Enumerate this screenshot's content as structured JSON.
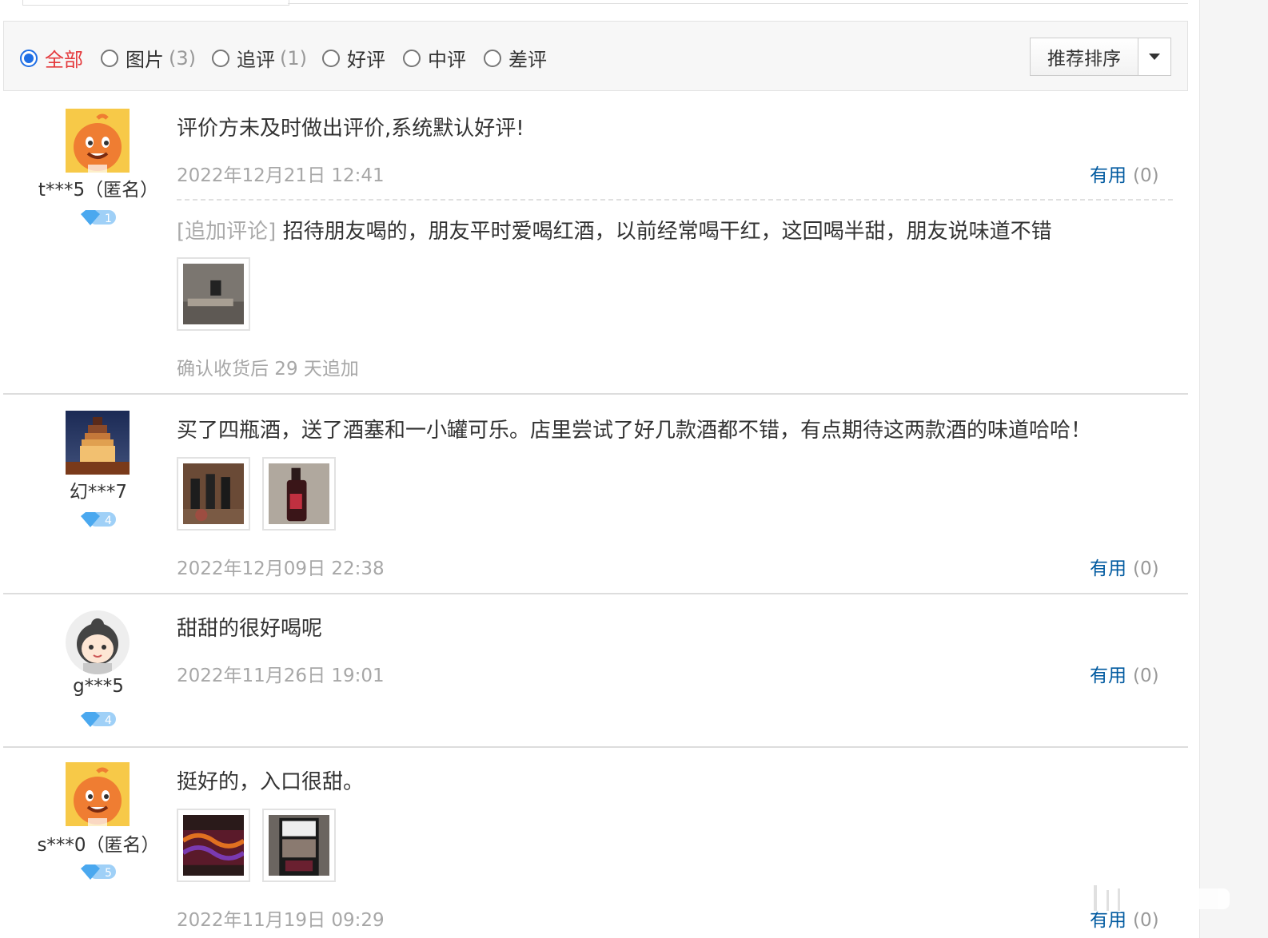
{
  "filters": {
    "items": [
      {
        "label": "全部",
        "count": "",
        "selected": true
      },
      {
        "label": "图片",
        "count": "(3)",
        "selected": false
      },
      {
        "label": "追评",
        "count": "(1)",
        "selected": false
      },
      {
        "label": "好评",
        "count": "",
        "selected": false
      },
      {
        "label": "中评",
        "count": "",
        "selected": false
      },
      {
        "label": "差评",
        "count": "",
        "selected": false
      }
    ],
    "sort_label": "推荐排序"
  },
  "reviews": [
    {
      "user": "t***5（匿名）",
      "level": "1",
      "text": "评价方未及时做出评价,系统默认好评!",
      "date": "2022年12月21日 12:41",
      "useful_label": "有用",
      "useful_count": "(0)",
      "append_tag": "[追加评论]",
      "append_text": "招待朋友喝的，朋友平时爱喝红酒，以前经常喝干红，这回喝半甜，朋友说味道不错",
      "append_note": "确认收货后 29 天追加"
    },
    {
      "user": "幻***7",
      "level": "4",
      "text": "买了四瓶酒，送了酒塞和一小罐可乐。店里尝试了好几款酒都不错，有点期待这两款酒的味道哈哈！",
      "date": "2022年12月09日 22:38",
      "useful_label": "有用",
      "useful_count": "(0)"
    },
    {
      "user": "g***5",
      "level": "4",
      "text": "甜甜的很好喝呢",
      "date": "2022年11月26日 19:01",
      "useful_label": "有用",
      "useful_count": "(0)"
    },
    {
      "user": "s***0（匿名）",
      "level": "5",
      "text": "挺好的，入口很甜。",
      "date": "2022年11月19日 09:29",
      "useful_label": "有用",
      "useful_count": "(0)"
    }
  ],
  "colors": {
    "accent_red": "#e4393c",
    "link_blue": "#005aa0",
    "radio_blue": "#1f6fe5",
    "muted": "#a7a7a7"
  },
  "icons": [
    "mascot-avatar-icon",
    "tower-avatar-icon",
    "girl-avatar-icon",
    "diamond-level-badge-icon",
    "dropdown-caret-icon"
  ]
}
